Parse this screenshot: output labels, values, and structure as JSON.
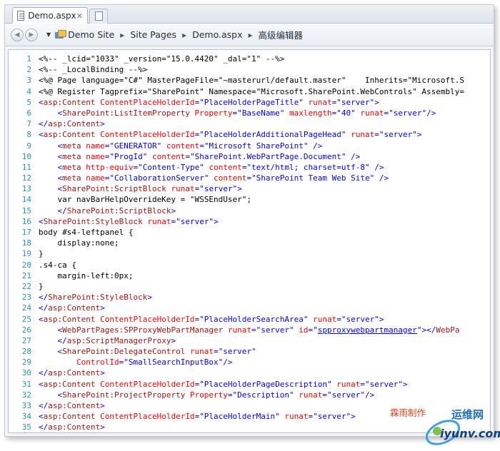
{
  "tab": {
    "title": "Demo.aspx"
  },
  "breadcrumb": [
    "Demo Site",
    "Site Pages",
    "Demo.aspx",
    "高级编辑器"
  ],
  "colors": {
    "tag": "#a31515",
    "attr": "#ff0000",
    "value": "#0000ff",
    "directive": "#000000",
    "line_number": "#2b91af",
    "link": "#0000ff"
  },
  "code_lines": [
    [
      [
        "<%-- _lcid=\"1033\" _version=\"15.0.4420\" _dal=\"1\" --%>",
        "directive"
      ]
    ],
    [
      [
        "<%-- _LocalBinding --%>",
        "directive"
      ]
    ],
    [
      [
        "<%@ Page language=\"C#\" MasterPageFile=\"~masterurl/default.master\"    Inherits=\"Microsoft.S",
        "directive"
      ]
    ],
    [
      [
        "<%@ Register Tagprefix=\"SharePoint\" Namespace=\"Microsoft.SharePoint.WebControls\" Assembly=",
        "directive"
      ]
    ],
    [
      [
        "<",
        "value"
      ],
      [
        "asp:Content",
        "tag"
      ],
      [
        " ContentPlaceHolderId",
        "attr"
      ],
      [
        "=",
        "value"
      ],
      [
        "\"PlaceHolderPageTitle\"",
        "value"
      ],
      [
        " runat",
        "attr"
      ],
      [
        "=",
        "value"
      ],
      [
        "\"server\"",
        "value"
      ],
      [
        ">",
        "value"
      ]
    ],
    [
      [
        "    <",
        "value"
      ],
      [
        "SharePoint:ListItemProperty",
        "tag"
      ],
      [
        " Property",
        "attr"
      ],
      [
        "=",
        "value"
      ],
      [
        "\"BaseName\"",
        "value"
      ],
      [
        " maxlength",
        "attr"
      ],
      [
        "=",
        "value"
      ],
      [
        "\"40\"",
        "value"
      ],
      [
        " runat",
        "attr"
      ],
      [
        "=",
        "value"
      ],
      [
        "\"server\"",
        "value"
      ],
      [
        "/>",
        "value"
      ]
    ],
    [
      [
        "</",
        "value"
      ],
      [
        "asp:Content",
        "tag"
      ],
      [
        ">",
        "value"
      ]
    ],
    [
      [
        "<",
        "value"
      ],
      [
        "asp:Content",
        "tag"
      ],
      [
        " ContentPlaceHolderId",
        "attr"
      ],
      [
        "=",
        "value"
      ],
      [
        "\"PlaceHolderAdditionalPageHead\"",
        "value"
      ],
      [
        " runat",
        "attr"
      ],
      [
        "=",
        "value"
      ],
      [
        "\"server\"",
        "value"
      ],
      [
        ">",
        "value"
      ]
    ],
    [
      [
        "    <",
        "value"
      ],
      [
        "meta",
        "tag"
      ],
      [
        " name",
        "attr"
      ],
      [
        "=",
        "value"
      ],
      [
        "\"GENERATOR\"",
        "value"
      ],
      [
        " content",
        "attr"
      ],
      [
        "=",
        "value"
      ],
      [
        "\"Microsoft SharePoint\"",
        "value"
      ],
      [
        " />",
        "value"
      ]
    ],
    [
      [
        "    <",
        "value"
      ],
      [
        "meta",
        "tag"
      ],
      [
        " name",
        "attr"
      ],
      [
        "=",
        "value"
      ],
      [
        "\"ProgId\"",
        "value"
      ],
      [
        " content",
        "attr"
      ],
      [
        "=",
        "value"
      ],
      [
        "\"SharePoint.WebPartPage.Document\"",
        "value"
      ],
      [
        " />",
        "value"
      ]
    ],
    [
      [
        "    <",
        "value"
      ],
      [
        "meta",
        "tag"
      ],
      [
        " http-equiv",
        "attr"
      ],
      [
        "=",
        "value"
      ],
      [
        "\"Content-Type\"",
        "value"
      ],
      [
        " content",
        "attr"
      ],
      [
        "=",
        "value"
      ],
      [
        "\"text/html; charset=utf-8\"",
        "value"
      ],
      [
        " />",
        "value"
      ]
    ],
    [
      [
        "    <",
        "value"
      ],
      [
        "meta",
        "tag"
      ],
      [
        " name",
        "attr"
      ],
      [
        "=",
        "value"
      ],
      [
        "\"CollaborationServer\"",
        "value"
      ],
      [
        " content",
        "attr"
      ],
      [
        "=",
        "value"
      ],
      [
        "\"SharePoint Team Web Site\"",
        "value"
      ],
      [
        " />",
        "value"
      ]
    ],
    [
      [
        "    <",
        "value"
      ],
      [
        "SharePoint:ScriptBlock",
        "tag"
      ],
      [
        " runat",
        "attr"
      ],
      [
        "=",
        "value"
      ],
      [
        "\"server\"",
        "value"
      ],
      [
        ">",
        "value"
      ]
    ],
    [
      [
        "    var navBarHelpOverrideKey = \"WSSEndUser\";",
        "directive"
      ]
    ],
    [
      [
        "    </",
        "value"
      ],
      [
        "SharePoint:ScriptBlock",
        "tag"
      ],
      [
        ">",
        "value"
      ]
    ],
    [
      [
        "<",
        "value"
      ],
      [
        "SharePoint:StyleBlock",
        "tag"
      ],
      [
        " runat",
        "attr"
      ],
      [
        "=",
        "value"
      ],
      [
        "\"server\"",
        "value"
      ],
      [
        ">",
        "value"
      ]
    ],
    [
      [
        "body #s4-leftpanel {",
        "directive"
      ]
    ],
    [
      [
        "    display:none;",
        "directive"
      ]
    ],
    [
      [
        "}",
        "directive"
      ]
    ],
    [
      [
        ".s4-ca {",
        "directive"
      ]
    ],
    [
      [
        "    margin-left:0px;",
        "directive"
      ]
    ],
    [
      [
        "}",
        "directive"
      ]
    ],
    [
      [
        "</",
        "value"
      ],
      [
        "SharePoint:StyleBlock",
        "tag"
      ],
      [
        ">",
        "value"
      ]
    ],
    [
      [
        "</",
        "value"
      ],
      [
        "asp:Content",
        "tag"
      ],
      [
        ">",
        "value"
      ]
    ],
    [
      [
        "<",
        "value"
      ],
      [
        "asp:Content",
        "tag"
      ],
      [
        " ContentPlaceHolderId",
        "attr"
      ],
      [
        "=",
        "value"
      ],
      [
        "\"PlaceHolderSearchArea\"",
        "value"
      ],
      [
        " runat",
        "attr"
      ],
      [
        "=",
        "value"
      ],
      [
        "\"server\"",
        "value"
      ],
      [
        ">",
        "value"
      ]
    ],
    [
      [
        "    <",
        "value"
      ],
      [
        "WebPartPages:SPProxyWebPartManager",
        "tag"
      ],
      [
        " runat",
        "attr"
      ],
      [
        "=",
        "value"
      ],
      [
        "\"server\"",
        "value"
      ],
      [
        " id",
        "attr"
      ],
      [
        "=",
        "value"
      ],
      [
        "\"",
        "value"
      ],
      [
        "spproxywebpartmanager",
        "link"
      ],
      [
        "\"",
        "value"
      ],
      [
        "></",
        "value"
      ],
      [
        "WebPa",
        "tag"
      ]
    ],
    [
      [
        "    </",
        "value"
      ],
      [
        "asp:ScriptManagerProxy",
        "tag"
      ],
      [
        ">",
        "value"
      ]
    ],
    [
      [
        "    <",
        "value"
      ],
      [
        "SharePoint:DelegateControl",
        "tag"
      ],
      [
        " runat",
        "attr"
      ],
      [
        "=",
        "value"
      ],
      [
        "\"server\"",
        "value"
      ]
    ],
    [
      [
        "        ControlId",
        "attr"
      ],
      [
        "=",
        "value"
      ],
      [
        "\"SmallSearchInputBox\"",
        "value"
      ],
      [
        "/>",
        "value"
      ]
    ],
    [
      [
        "</",
        "value"
      ],
      [
        "asp:Content",
        "tag"
      ],
      [
        ">",
        "value"
      ]
    ],
    [
      [
        "<",
        "value"
      ],
      [
        "asp:Content",
        "tag"
      ],
      [
        " ContentPlaceHolderId",
        "attr"
      ],
      [
        "=",
        "value"
      ],
      [
        "\"PlaceHolderPageDescription\"",
        "value"
      ],
      [
        " runat",
        "attr"
      ],
      [
        "=",
        "value"
      ],
      [
        "\"server\"",
        "value"
      ],
      [
        ">",
        "value"
      ]
    ],
    [
      [
        "    <",
        "value"
      ],
      [
        "SharePoint:ProjectProperty",
        "tag"
      ],
      [
        " Property",
        "attr"
      ],
      [
        "=",
        "value"
      ],
      [
        "\"Description\"",
        "value"
      ],
      [
        " runat",
        "attr"
      ],
      [
        "=",
        "value"
      ],
      [
        "\"server\"",
        "value"
      ],
      [
        "/>",
        "value"
      ]
    ],
    [
      [
        "</",
        "value"
      ],
      [
        "asp:Content",
        "tag"
      ],
      [
        ">",
        "value"
      ]
    ],
    [
      [
        "<",
        "value"
      ],
      [
        "asp:Content",
        "tag"
      ],
      [
        " ContentPlaceHolderId",
        "attr"
      ],
      [
        "=",
        "value"
      ],
      [
        "\"PlaceHolderMain\"",
        "value"
      ],
      [
        " runat",
        "attr"
      ],
      [
        "=",
        "value"
      ],
      [
        "\"server\"",
        "value"
      ],
      [
        ">",
        "value"
      ]
    ],
    [
      [
        "</",
        "value"
      ],
      [
        "asp:Content",
        "tag"
      ],
      [
        ">",
        "value"
      ]
    ],
    [
      [
        "",
        "directive"
      ]
    ]
  ],
  "annotation": "霖雨制作",
  "watermark": {
    "text": "运维网",
    "url": "iyunv.com"
  }
}
